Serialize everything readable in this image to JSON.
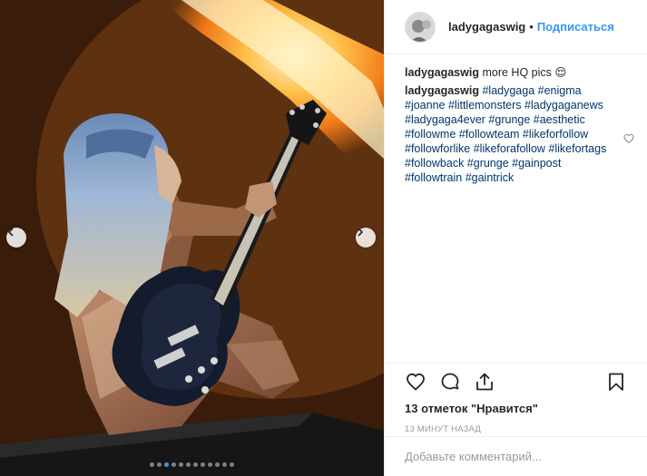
{
  "post": {
    "username": "ladygagaswig",
    "separator": "•",
    "follow_label": "Подписаться",
    "caption_user": "ladygagaswig",
    "caption_text": "more HQ pics 😌",
    "tags_user": "ladygagaswig",
    "tag_lines": [
      "#ladygaga #enigma",
      "#joanne #littlemonsters #ladygaganews",
      "#ladygaga4ever #grunge #aesthetic",
      "#followme #followteam #likeforfollow",
      "#followforlike #likeforafollow #likefortags",
      "#followback #grunge #gainpost",
      "#followtrain #gaintrick"
    ],
    "likes_text": "13 отметок \"Нравится\"",
    "time_text": "13 МИНУТ НАЗАД",
    "add_comment_placeholder": "Добавьте комментарий..."
  },
  "carousel": {
    "slide_count": 12,
    "active_index": 2,
    "accent": "#3897f0"
  },
  "icons": [
    "chevron-left-icon",
    "chevron-right-icon",
    "heart-icon",
    "comment-icon",
    "share-icon",
    "bookmark-icon",
    "small-heart-icon"
  ]
}
